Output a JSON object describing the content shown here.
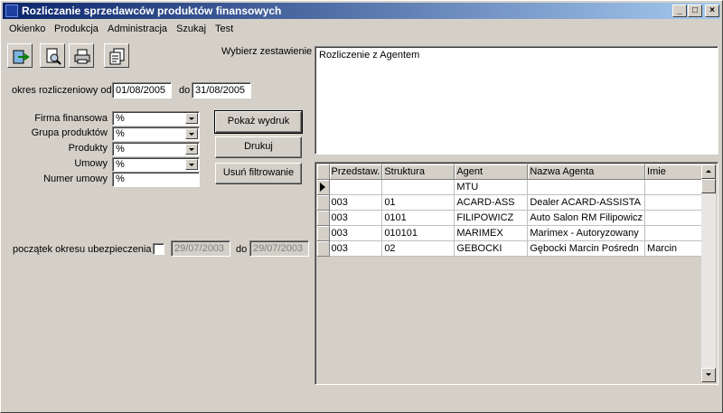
{
  "window": {
    "title": "Rozliczanie sprzedawców produktów finansowych",
    "minimize": "_",
    "restore": "□",
    "close": "×"
  },
  "menu": [
    "Okienko",
    "Produkcja",
    "Administracja",
    "Szukaj",
    "Test"
  ],
  "toolbar": {
    "icons": [
      "exit-icon",
      "preview-icon",
      "print-icon",
      "copy-icon"
    ]
  },
  "period": {
    "label": "okres rozliczeniowy od",
    "from": "01/08/2005",
    "to_label": "do",
    "to": "31/08/2005"
  },
  "filters": {
    "firma_label": "Firma finansowa",
    "firma_value": "%",
    "grupa_label": "Grupa produktów",
    "grupa_value": "%",
    "produkty_label": "Produkty",
    "produkty_value": "%",
    "umowy_label": "Umowy",
    "umowy_value": "%",
    "numer_label": "Numer umowy",
    "numer_value": "%"
  },
  "buttons": {
    "pokaz": "Pokaż wydruk",
    "drukuj": "Drukuj",
    "usun": "Usuń filtrowanie"
  },
  "insurance": {
    "label": "początek okresu ubezpieczenia",
    "checked": false,
    "from": "29/07/2003",
    "to_label": "do",
    "to": "29/07/2003"
  },
  "report": {
    "label": "Wybierz zestawienie",
    "selected": "Rozliczenie z Agentem"
  },
  "grid": {
    "columns": [
      "Przedstaw.",
      "Struktura",
      "Agent",
      "Nazwa Agenta",
      "Imie"
    ],
    "rows": [
      [
        "",
        "",
        "MTU",
        "",
        ""
      ],
      [
        "003",
        "01",
        "ACARD-ASS",
        "Dealer ACARD-ASSISTA",
        ""
      ],
      [
        "003",
        "0101",
        "FILIPOWICZ",
        "Auto Salon RM Filipowicz",
        ""
      ],
      [
        "003",
        "010101",
        "MARIMEX",
        "Marimex - Autoryzowany",
        ""
      ],
      [
        "003",
        "02",
        "GEBOCKI",
        "Gębocki Marcin Pośredn",
        "Marcin"
      ]
    ]
  }
}
